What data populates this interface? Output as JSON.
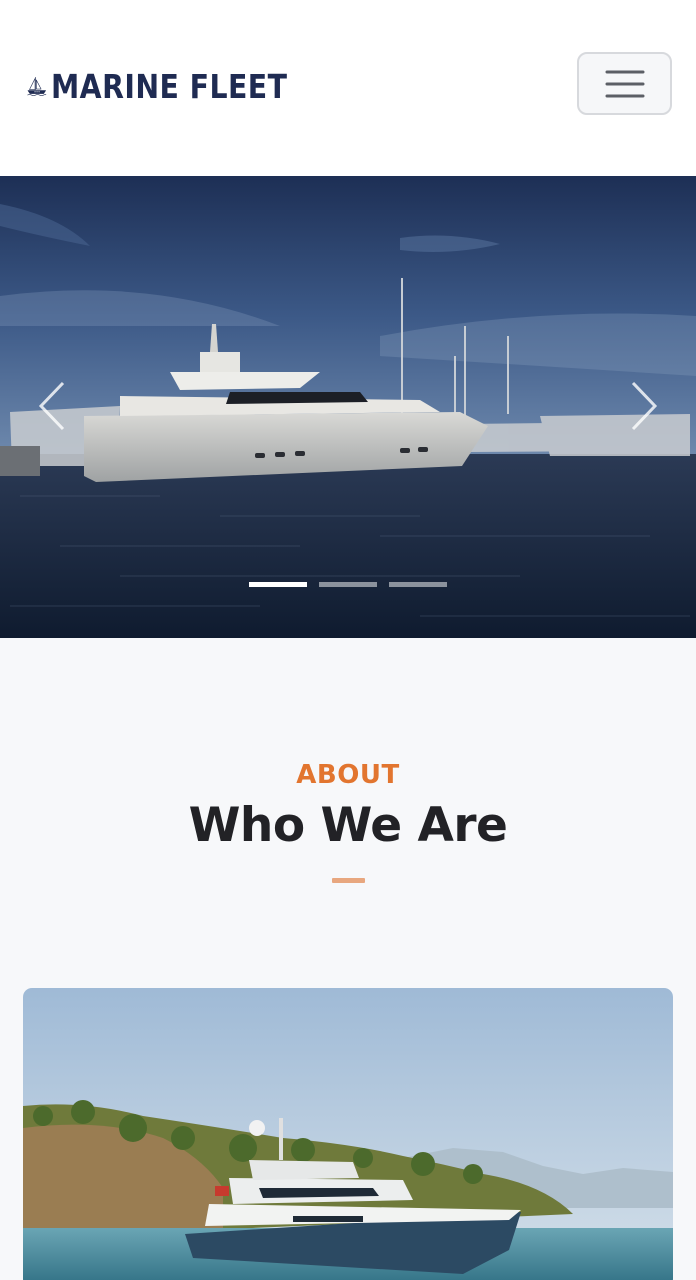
{
  "header": {
    "brand": "MARINE FLEET",
    "logo_icon": "sailboat-icon",
    "menu_icon": "hamburger-menu-icon"
  },
  "hero": {
    "prev_icon": "chevron-left-icon",
    "next_icon": "chevron-right-icon",
    "slide_count": 3,
    "active_slide": 1
  },
  "about": {
    "eyebrow": "ABOUT",
    "title": "Who We Are"
  },
  "colors": {
    "brand_navy": "#1f2b52",
    "accent_orange": "#e2752f",
    "divider": "#e8a77f",
    "section_bg": "#f7f8fa"
  }
}
